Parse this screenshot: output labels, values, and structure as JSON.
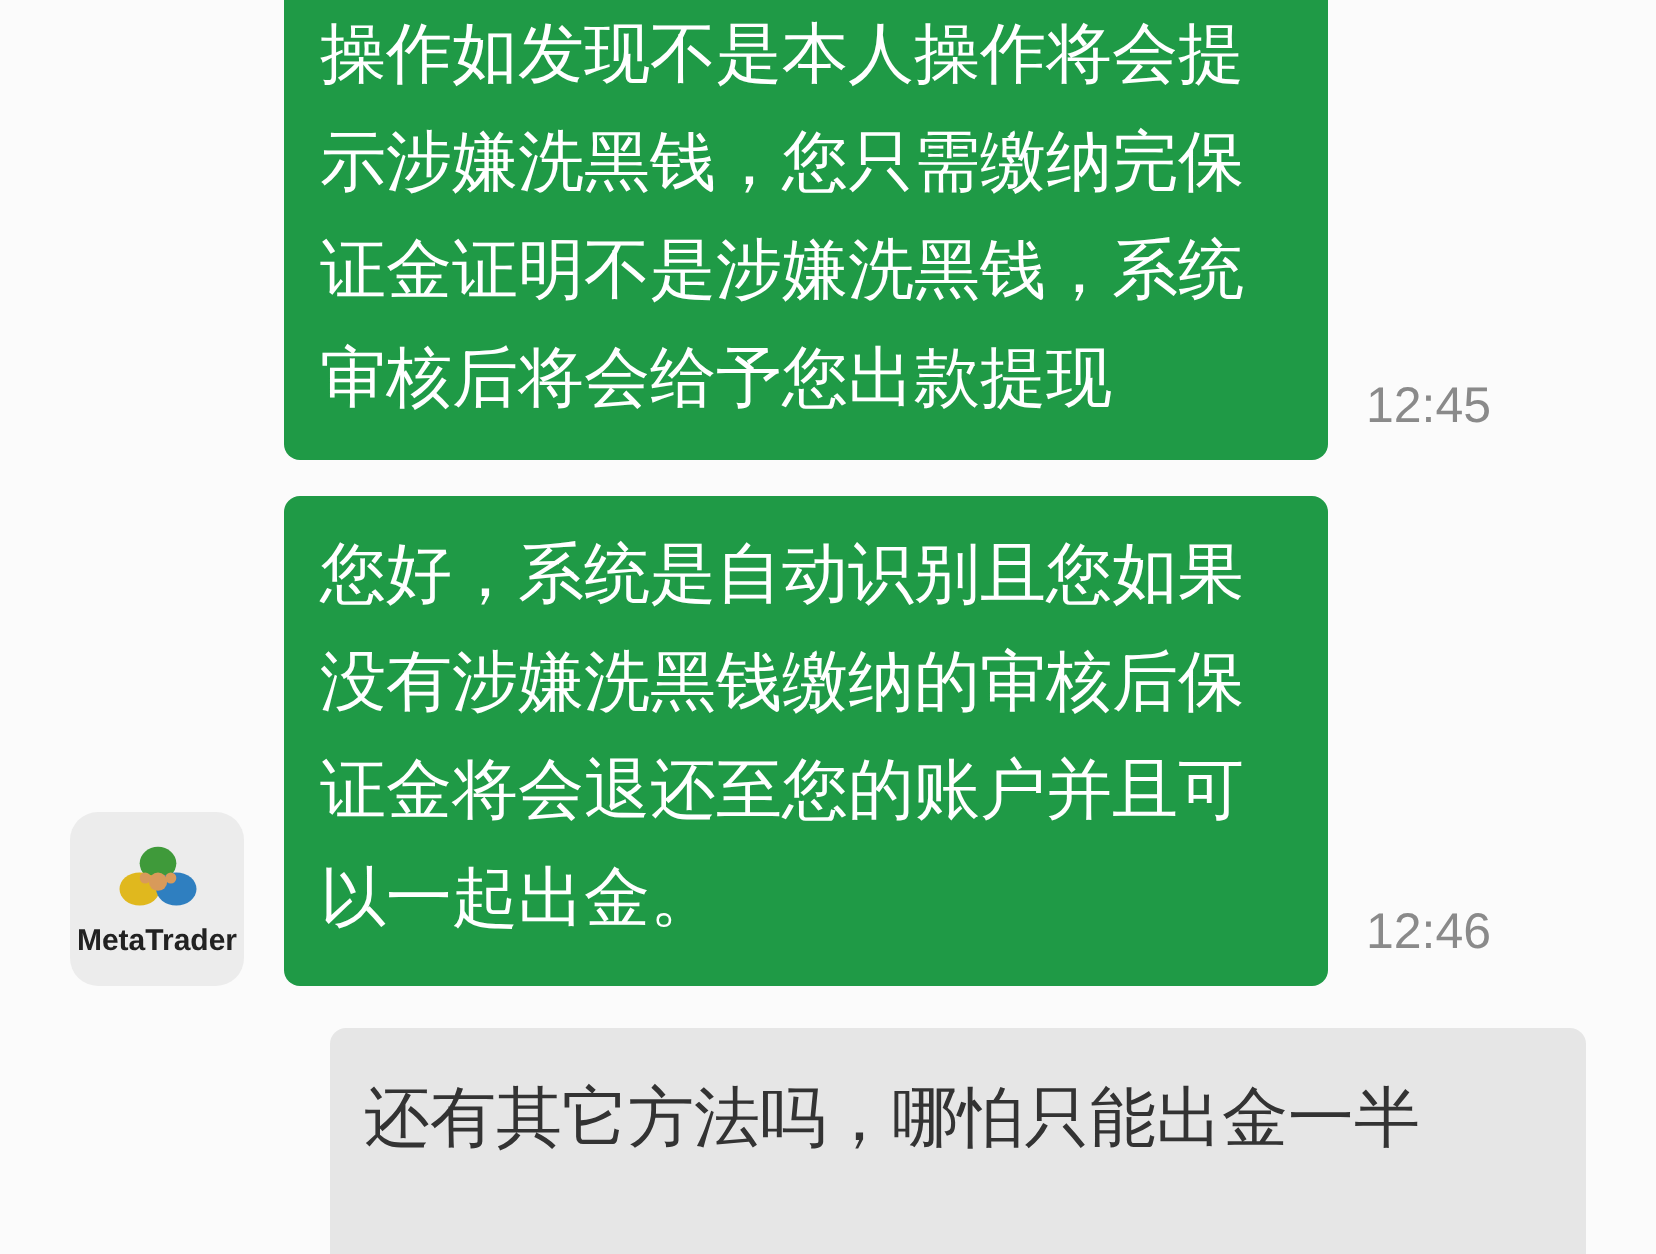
{
  "messages": [
    {
      "kind": "incoming",
      "text": "操作如发现不是本人操作将会提示涉嫌洗黑钱，您只需缴纳完保证金证明不是涉嫌洗黑钱，系统审核后将会给予您出款提现",
      "time": "12:45"
    },
    {
      "kind": "incoming",
      "text": "您好，系统是自动识别且您如果没有涉嫌洗黑钱缴纳的审核后保证金将会退还至您的账户并且可以一起出金。",
      "time": "12:46",
      "avatar": {
        "label": "MetaTrader"
      }
    },
    {
      "kind": "outgoing",
      "text": "还有其它方法吗，哪怕只能出金一半"
    }
  ]
}
